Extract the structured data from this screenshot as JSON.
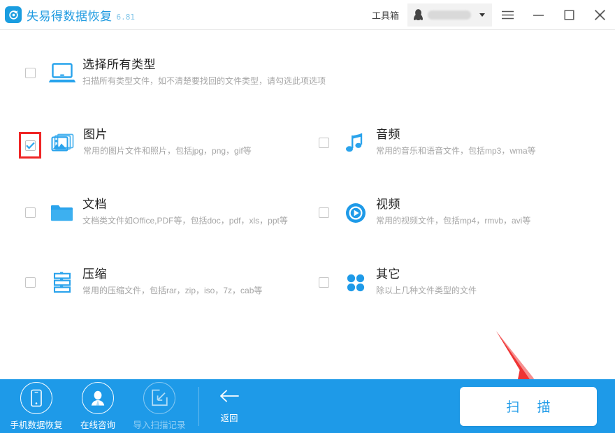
{
  "titlebar": {
    "app_name": "失易得数据恢复",
    "version": "6.81",
    "toolbox_label": "工具箱",
    "account_name": "",
    "logo_icon": "recovery-logo-icon",
    "qq_icon": "qq-penguin-icon",
    "caret_icon": "chevron-down-icon",
    "menu_icon": "hamburger-menu-icon",
    "minimize_icon": "minimize-icon",
    "maximize_icon": "maximize-icon",
    "close_icon": "close-icon"
  },
  "colors": {
    "brand_blue": "#1e9ae8",
    "accent_red": "#ef2525",
    "title_text": "#222222",
    "desc_text": "#a6a6a6"
  },
  "file_types": [
    {
      "id": "all",
      "title": "选择所有类型",
      "desc": "扫描所有类型文件，如不清楚要找回的文件类型，请勾选此项选项",
      "icon": "laptop-icon",
      "checked": false,
      "highlighted": false
    },
    {
      "id": "images",
      "title": "图片",
      "desc": "常用的图片文件和照片，包括jpg，png，gif等",
      "icon": "photo-stack-icon",
      "checked": true,
      "highlighted": true
    },
    {
      "id": "audio",
      "title": "音频",
      "desc": "常用的音乐和语音文件，包括mp3，wma等",
      "icon": "music-note-icon",
      "checked": false,
      "highlighted": false
    },
    {
      "id": "documents",
      "title": "文档",
      "desc": "文档类文件如Office,PDF等，包括doc，pdf，xls，ppt等",
      "icon": "folder-icon",
      "checked": false,
      "highlighted": false
    },
    {
      "id": "video",
      "title": "视频",
      "desc": "常用的视频文件，包括mp4，rmvb，avi等",
      "icon": "play-circle-icon",
      "checked": false,
      "highlighted": false
    },
    {
      "id": "archive",
      "title": "压缩",
      "desc": "常用的压缩文件，包括rar，zip，iso，7z，cab等",
      "icon": "archive-stack-icon",
      "checked": false,
      "highlighted": false
    },
    {
      "id": "other",
      "title": "其它",
      "desc": "除以上几种文件类型的文件",
      "icon": "four-dots-icon",
      "checked": false,
      "highlighted": false
    }
  ],
  "bottombar": {
    "items": [
      {
        "label": "手机数据恢复",
        "icon": "mobile-phone-icon",
        "disabled": false
      },
      {
        "label": "在线咨询",
        "icon": "person-icon",
        "disabled": false
      },
      {
        "label": "导入扫描记录",
        "icon": "import-arrow-icon",
        "disabled": true
      }
    ],
    "back_label": "返回",
    "back_icon": "arrow-left-icon",
    "scan_label": "扫 描"
  },
  "annotation": {
    "arrow_icon": "red-pointer-arrow-icon",
    "color": "#ef2525"
  }
}
